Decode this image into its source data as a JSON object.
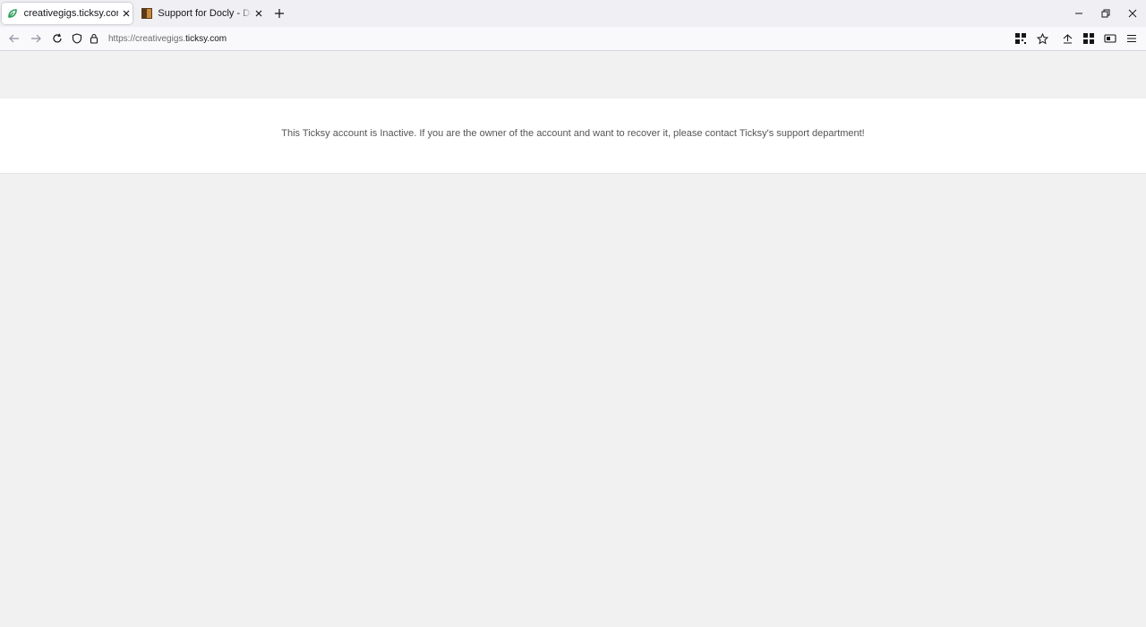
{
  "browser": {
    "tabs": [
      {
        "title": "creativegigs.ticksy.com/",
        "active": true,
        "favicon": "ticksy-leaf-icon"
      },
      {
        "title": "Support for Docly - Documentation",
        "active": false,
        "favicon": "docly-icon"
      }
    ],
    "url": {
      "prefix": "https://creativegigs.",
      "domain": "ticksy.com",
      "full": "https://creativegigs.ticksy.com"
    }
  },
  "page": {
    "notice": "This Ticksy account is Inactive. If you are the owner of the account and want to recover it, please contact Ticksy's support department!"
  },
  "colors": {
    "page_background": "#f1f1f1",
    "band_background": "#ffffff",
    "text": "#555555",
    "favicon_green": "#2e9e5b"
  }
}
